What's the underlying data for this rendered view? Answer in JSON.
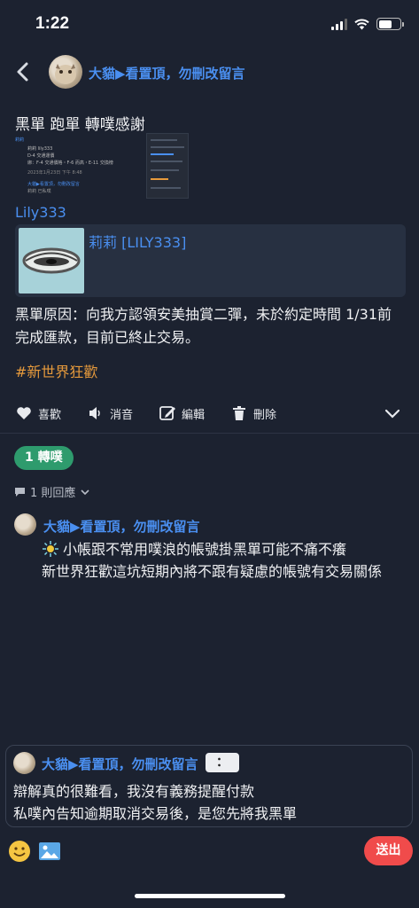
{
  "status_bar": {
    "time": "1:22"
  },
  "header": {
    "name": "大貓▶看置頂，勿刪改留言"
  },
  "post": {
    "title": "黑單 跑單 轉噗感謝",
    "thumbnail": {
      "name": "莉莉",
      "line1": "莉莉 lily333",
      "line2": "D-4 交通運價",
      "line3": "綁：F-4 交通價格・F-6 而高・E-11 交換榜",
      "line4": "2023年1月23日 下午 8:48",
      "footer_name": "大貓▶看置頂，勿刪改留言",
      "footer_sub": "莉莉 已私噗"
    },
    "link_user": "Lily333",
    "card_title": "莉莉 [LILY333]",
    "body": "黑單原因：向我方認領安美抽賞二彈，未於約定時間 1/31前完成匯款，目前已終止交易。",
    "hashtag": "#新世界狂歡"
  },
  "actions": {
    "like": "喜歡",
    "mute": "消音",
    "edit": "編輯",
    "delete": "刪除"
  },
  "replurk_label": "1 轉噗",
  "reply_count": "1 則回應",
  "comment": {
    "name": "大貓▶看置頂，勿刪改留言",
    "line1": "小帳跟不常用噗浪的帳號掛黑單可能不痛不癢",
    "line2": "新世界狂歡這坑短期內將不跟有疑慮的帳號有交易關係"
  },
  "compose": {
    "name": "大貓▶看置頂，勿刪改留言",
    "kaomoji": "：",
    "line1": "辯解真的很難看，我沒有義務提醒付款",
    "line2": "私噗內告知逾期取消交易後，是您先將我黑單"
  },
  "send_label": "送出",
  "colors": {
    "background": "#1c2230",
    "link_blue": "#4a8ff0",
    "hashtag_orange": "#e69a3c",
    "replurk_green": "#2e9b6d",
    "send_red": "#f04b4b"
  }
}
